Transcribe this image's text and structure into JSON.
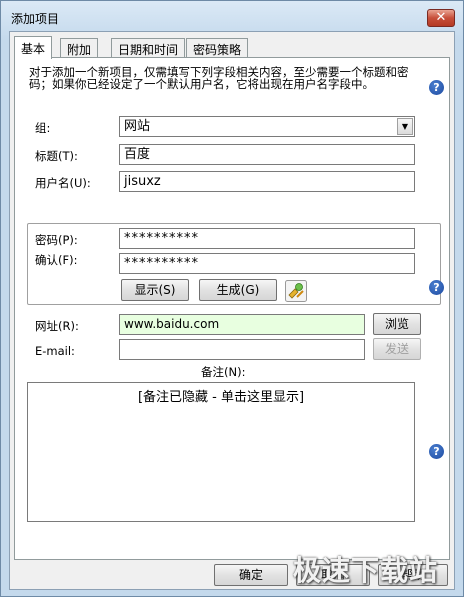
{
  "window": {
    "title": "添加项目",
    "close_glyph": "✕"
  },
  "tabs": [
    "基本",
    "附加",
    "日期和时间",
    "密码策略"
  ],
  "description": "对于添加一个新项目，仅需填写下列字段相关内容，至少需要一个标题和密码；如果你已经设定了一个默认用户名，它将出现在用户名字段中。",
  "help_glyph": "?",
  "form": {
    "group_label": "组:",
    "group_value": "网站",
    "title_label": "标题(T):",
    "title_value": "百度",
    "username_label": "用户名(U):",
    "username_value": "jisuxz",
    "password_label": "密码(P):",
    "password_value": "**********",
    "confirm_label": "确认(F):",
    "confirm_value": "**********",
    "show_button": "显示(S)",
    "generate_button": "生成(G)",
    "url_label": "网址(R):",
    "url_value": "www.baidu.com",
    "browse_button": "浏览",
    "email_label": "E-mail:",
    "email_value": "",
    "send_button": "发送",
    "notes_label": "备注(N):",
    "notes_hidden_text": "[备注已隐藏 - 单击这里显示]"
  },
  "footer": {
    "ok_button": "确定",
    "cancel_button": "取消",
    "help_button": "帮助"
  },
  "watermark": "极速下载站",
  "colors": {
    "url_field_bg": "#e8ffe0",
    "help_icon": "#1d4aa0",
    "close_button": "#c74f3a"
  }
}
